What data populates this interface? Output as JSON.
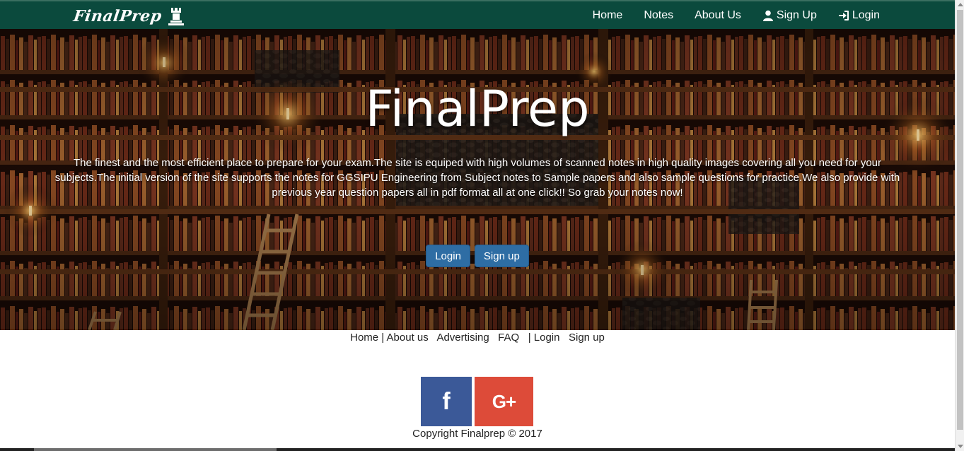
{
  "navbar": {
    "brand": "FinalPrep",
    "links": {
      "home": "Home",
      "notes": "Notes",
      "about": "About Us",
      "signup": "Sign Up",
      "login": "Login"
    }
  },
  "hero": {
    "title": "FinalPrep",
    "description": "The finest and the most efficient place to prepare for your exam.The site is equiped with high volumes of scanned notes in high quality images covering all you need for your subjects.The initial version of the site supports the notes for GGSIPU Engineering from Subject notes to Sample papers and also sample questions for practice.We also provide with previous year question papers all in pdf format all at one click!! So grab your notes now!",
    "login_button": "Login",
    "signup_button": "Sign up"
  },
  "footer": {
    "links": {
      "home": "Home",
      "sep1": " | ",
      "about": "About us",
      "advertising": "Advertising",
      "faq": "FAQ",
      "sep2": "| ",
      "login": "Login",
      "signup": "Sign up"
    },
    "social": {
      "facebook": "f",
      "google_plus": "G+"
    },
    "copyright": "Copyright Finalprep © 2017"
  },
  "colors": {
    "navbar": "#0b4a3d",
    "button": "#2e6da4",
    "facebook": "#3b5998",
    "google_plus": "#dd4b39"
  }
}
